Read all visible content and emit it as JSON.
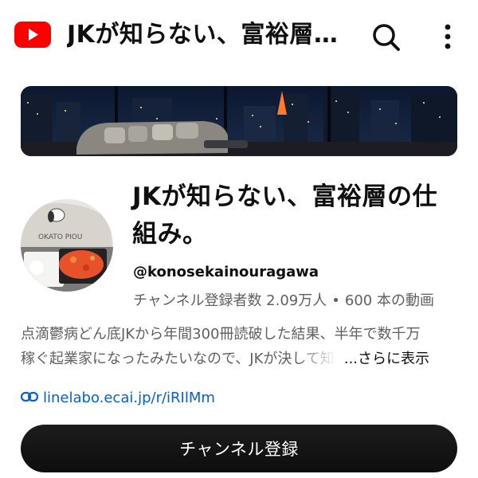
{
  "app": {
    "title": "JKが知らない、富裕層…"
  },
  "icons": {
    "logo": "youtube-logo-icon",
    "search": "search-icon",
    "menu": "more-vert-icon",
    "link": "link-icon"
  },
  "colors": {
    "brand_red": "#ff0000",
    "link_blue": "#065fd4",
    "secondary_text": "#606060",
    "subscribe_bg": "#0f0f0f"
  },
  "channel": {
    "name": "JKが知らない、富裕層の仕組み。",
    "handle": "@konosekainouragawa",
    "subscribers": "チャンネル登録者数 2.09万人",
    "separator": "•",
    "videos": "600 本の動画",
    "description_line1": "点滴鬱病どん底JKから年間300冊読破した結果、半年で数千万",
    "description_line2": "稼ぐ起業家になったみたいなので、JKが決して知",
    "more_label": "...さらに表示",
    "link": "linelabo.ecai.jp/r/iRIlMm",
    "subscribe_label": "チャンネル登録"
  }
}
